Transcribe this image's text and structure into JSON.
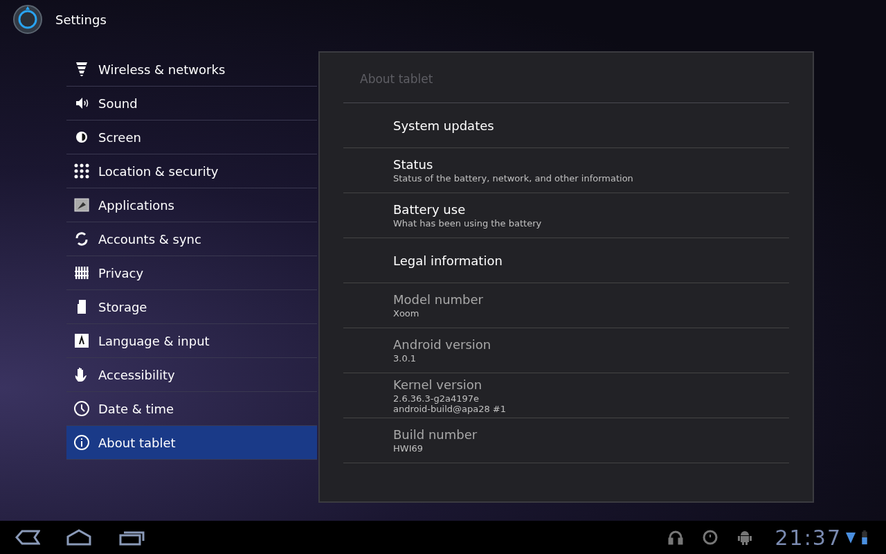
{
  "app_bar": {
    "title": "Settings"
  },
  "sidebar": {
    "items": [
      {
        "label": "Wireless & networks",
        "selected": false
      },
      {
        "label": "Sound",
        "selected": false
      },
      {
        "label": "Screen",
        "selected": false
      },
      {
        "label": "Location & security",
        "selected": false
      },
      {
        "label": "Applications",
        "selected": false
      },
      {
        "label": "Accounts & sync",
        "selected": false
      },
      {
        "label": "Privacy",
        "selected": false
      },
      {
        "label": "Storage",
        "selected": false
      },
      {
        "label": "Language & input",
        "selected": false
      },
      {
        "label": "Accessibility",
        "selected": false
      },
      {
        "label": "Date & time",
        "selected": false
      },
      {
        "label": "About tablet",
        "selected": true
      }
    ]
  },
  "detail": {
    "title": "About tablet",
    "items": [
      {
        "kind": "action",
        "title": "System updates"
      },
      {
        "kind": "action",
        "title": "Status",
        "summary": "Status of the battery, network, and other information"
      },
      {
        "kind": "action",
        "title": "Battery use",
        "summary": "What has been using the battery"
      },
      {
        "kind": "action",
        "title": "Legal information"
      },
      {
        "kind": "info",
        "title": "Model number",
        "summary": "Xoom"
      },
      {
        "kind": "info",
        "title": "Android version",
        "summary": "3.0.1"
      },
      {
        "kind": "info",
        "title": "Kernel version",
        "summary": "2.6.36.3-g2a4197e\nandroid-build@apa28 #1"
      },
      {
        "kind": "info",
        "title": "Build number",
        "summary": "HWI69"
      }
    ]
  },
  "status_bar": {
    "time": "21:37"
  }
}
